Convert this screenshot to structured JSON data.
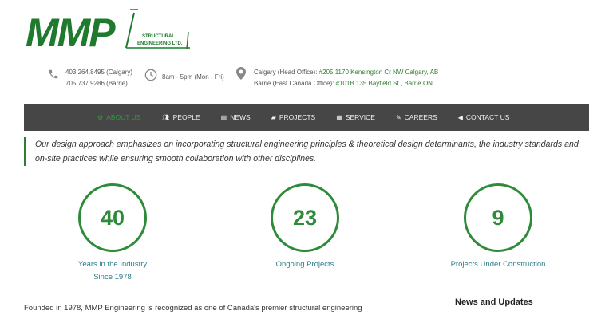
{
  "logo": {
    "main": "MMP",
    "line1": "STRUCTURAL",
    "line2": "ENGINEERING LTD."
  },
  "contact": {
    "phone_calgary": "403.264.8495 (Calgary)",
    "phone_barrie": "705.737.9286 (Barrie)",
    "hours": "8am - 5pm (Mon - Fri)",
    "head_office_label": "Calgary (Head Office): ",
    "head_office_address": "#205 1170 Kensington Cr NW Calgary, AB",
    "east_office_label": "Barrie (East Canada Office): ",
    "east_office_address": "#101B 135 Bayfield St., Barrie ON"
  },
  "nav": {
    "about": "ABOUT US",
    "people": "PEOPLE",
    "news": "NEWS",
    "projects": "PROJECTS",
    "service": "SERVICE",
    "careers": "CAREERS",
    "contact": "CONTACT US"
  },
  "quote": "Our design approach emphasizes on incorporating structural engineering principles & theoretical design determinants, the industry standards and on-site practices while ensuring smooth collaboration with other disciplines.",
  "stats": {
    "years": {
      "value": "40",
      "label1": "Years in the Industry",
      "label2": "Since 1978"
    },
    "ongoing": {
      "value": "23",
      "label1": "Ongoing Projects"
    },
    "construction": {
      "value": "9",
      "label1": "Projects Under Construction"
    }
  },
  "about_text": "Founded in 1978, MMP Engineering is recognized as one of Canada's premier structural engineering",
  "news_heading": "News and Updates",
  "colors": {
    "brand_green": "#2e7d32",
    "nav_bg": "#464646",
    "stat_green": "#2e8b3a"
  }
}
